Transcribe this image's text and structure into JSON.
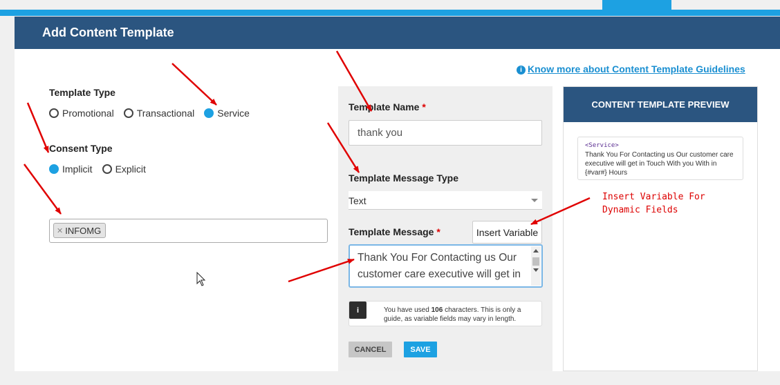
{
  "header": {
    "title": "Add Content Template"
  },
  "guidelines_link": {
    "label": "Know more about Content Template Guidelines",
    "icon": "info-circle-icon"
  },
  "template_type": {
    "label": "Template Type",
    "options": [
      "Promotional",
      "Transactional",
      "Service"
    ],
    "selected": "Service"
  },
  "consent_type": {
    "label": "Consent Type",
    "options": [
      "Implicit",
      "Explicit"
    ],
    "selected": "Implicit"
  },
  "sender_ids": {
    "tags": [
      "INFOMG"
    ],
    "remove_icon": "close-icon"
  },
  "template_name": {
    "label": "Template Name",
    "required_mark": "*",
    "value": "thank you"
  },
  "message_type": {
    "label": "Template Message Type",
    "selected": "Text"
  },
  "template_message": {
    "label": "Template Message",
    "required_mark": "*",
    "insert_variable_label": "Insert Variable",
    "value": "Thank You For Contacting us Our customer care executive will get in Touch With you With in {#var#} Hours"
  },
  "char_note": {
    "icon_glyph": "i",
    "prefix": "You have used",
    "count": "106",
    "suffix": "characters. This is only a guide, as variable fields may vary in length."
  },
  "actions": {
    "cancel_label": "CANCEL",
    "save_label": "SAVE"
  },
  "preview": {
    "title": "CONTENT TEMPLATE PREVIEW",
    "category_tag": "<Service>",
    "message": "Thank You For Contacting us Our customer care executive will get in Touch With you With in {#var#} Hours"
  },
  "annotation": {
    "line1": "Insert Variable For",
    "line2": "Dynamic Fields"
  },
  "colors": {
    "header_bg": "#2b5580",
    "accent": "#1da1e2",
    "annotation": "#dd0000"
  }
}
